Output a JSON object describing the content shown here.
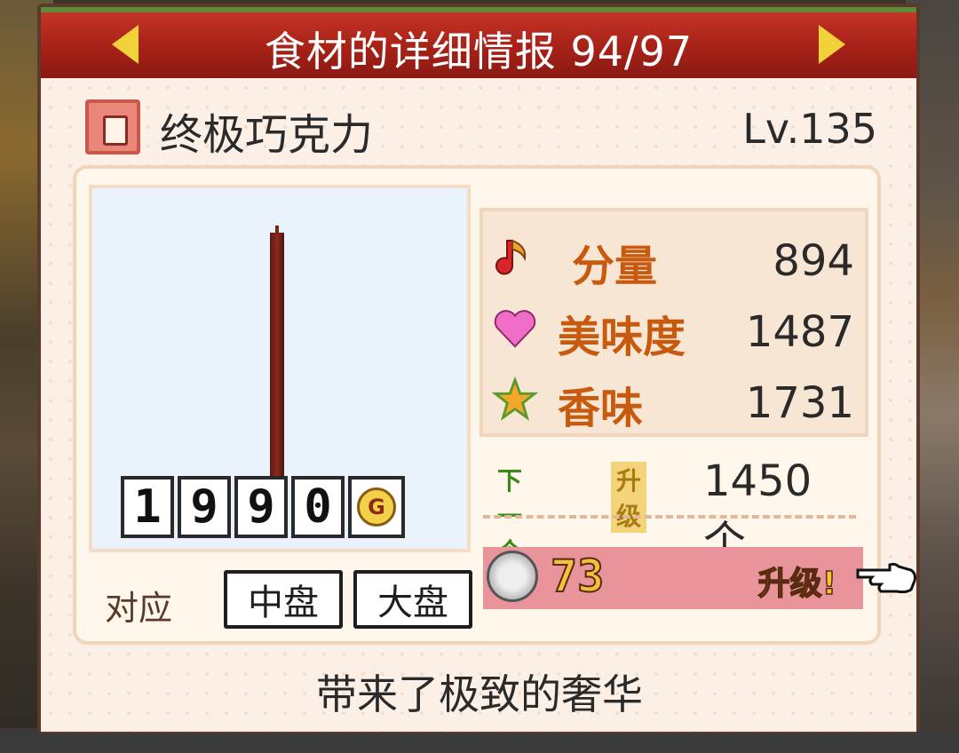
{
  "header": {
    "title": "食材的详细情报 94/97",
    "prev_icon": "arrow-left-icon",
    "next_icon": "arrow-right-icon"
  },
  "item": {
    "name": "终极巧克力",
    "level": "Lv.135",
    "icon": "ingredient-jar-icon"
  },
  "price": {
    "digits": [
      "1",
      "9",
      "9",
      "0"
    ],
    "currency": "G"
  },
  "compat": {
    "label": "对应",
    "plates": [
      "中盘",
      "大盘"
    ]
  },
  "stats": [
    {
      "icon": "music-note-icon",
      "label": "分量",
      "value": "894"
    },
    {
      "icon": "heart-icon",
      "label": "美味度",
      "value": "1487"
    },
    {
      "icon": "star-icon",
      "label": "香味",
      "value": "1731"
    }
  ],
  "next_level": {
    "tag_next": "下一个",
    "tag_levelup": "升级",
    "value": "1450个"
  },
  "upgrade": {
    "cost": "73",
    "label": "升级!"
  },
  "description": "带来了极致的奢华",
  "colors": {
    "title_bg": "#a82218",
    "accent_yellow": "#f2d23a",
    "upgrade_bar": "#e8949a",
    "stat_label": "#c85a10"
  }
}
